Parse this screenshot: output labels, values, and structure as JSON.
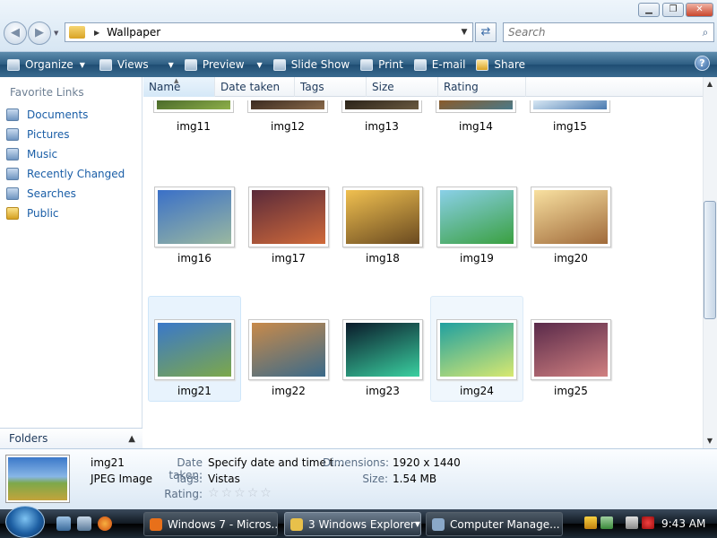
{
  "window": {
    "minimize": "▁",
    "maximize": "❐",
    "close": "✕"
  },
  "address": {
    "path": "Wallpaper",
    "search_placeholder": "Search"
  },
  "toolbar": {
    "organize": "Organize",
    "views": "Views",
    "preview": "Preview",
    "slideshow": "Slide Show",
    "print": "Print",
    "email": "E-mail",
    "share": "Share",
    "help": "?"
  },
  "nav": {
    "favorite_links_title": "Favorite Links",
    "items": [
      {
        "label": "Documents",
        "icon": "documents-icon"
      },
      {
        "label": "Pictures",
        "icon": "pictures-icon"
      },
      {
        "label": "Music",
        "icon": "music-icon"
      },
      {
        "label": "Recently Changed",
        "icon": "recently-changed-icon"
      },
      {
        "label": "Searches",
        "icon": "searches-icon"
      },
      {
        "label": "Public",
        "icon": "public-folder-icon"
      }
    ],
    "folders_label": "Folders"
  },
  "columns": [
    "Name",
    "Date taken",
    "Tags",
    "Size",
    "Rating"
  ],
  "files": [
    {
      "name": "img11",
      "colors": [
        "#4a6a2a",
        "#8fb04a"
      ],
      "partial": true
    },
    {
      "name": "img12",
      "colors": [
        "#3a2a20",
        "#8a6a4a"
      ],
      "partial": true
    },
    {
      "name": "img13",
      "colors": [
        "#2a2218",
        "#6a5a40"
      ],
      "partial": true
    },
    {
      "name": "img14",
      "colors": [
        "#8a5a2a",
        "#4a7a8a"
      ],
      "partial": true
    },
    {
      "name": "img15",
      "colors": [
        "#d8e8f4",
        "#4a7ab0"
      ],
      "partial": true
    },
    {
      "name": "img16",
      "colors": [
        "#3a70c8",
        "#9ab8a0"
      ]
    },
    {
      "name": "img17",
      "colors": [
        "#5a2a3a",
        "#d06a3a"
      ]
    },
    {
      "name": "img18",
      "colors": [
        "#f0c050",
        "#6a4a20"
      ]
    },
    {
      "name": "img19",
      "colors": [
        "#8ad0e8",
        "#3aa040"
      ]
    },
    {
      "name": "img20",
      "colors": [
        "#f8e0a0",
        "#a06a3a"
      ]
    },
    {
      "name": "img21",
      "colors": [
        "#3a78c9",
        "#7da84a"
      ],
      "selected": true
    },
    {
      "name": "img22",
      "colors": [
        "#c88a4a",
        "#3a6a8a"
      ]
    },
    {
      "name": "img23",
      "colors": [
        "#0a1a2a",
        "#3ad0a0"
      ]
    },
    {
      "name": "img24",
      "colors": [
        "#20a0a0",
        "#d8e870"
      ],
      "hover": true
    },
    {
      "name": "img25",
      "colors": [
        "#5a2a4a",
        "#d08080"
      ]
    }
  ],
  "details": {
    "name": "img21",
    "type": "JPEG Image",
    "date_label": "Date taken:",
    "date_value": "Specify date and time t...",
    "tags_label": "Tags:",
    "tags_value": "Vistas",
    "rating_label": "Rating:",
    "rating_stars": 0,
    "dimensions_label": "Dimensions:",
    "dimensions_value": "1920 x 1440",
    "size_label": "Size:",
    "size_value": "1.54 MB"
  },
  "taskbar": {
    "tasks": [
      {
        "label": "Windows 7 - Micros...",
        "icon": "firefox-icon",
        "color": "#e8701a"
      },
      {
        "label": "3 Windows Explorer",
        "icon": "explorer-folder-icon",
        "color": "#e8c04a",
        "active": true
      },
      {
        "label": "Computer Manage...",
        "icon": "computer-management-icon",
        "color": "#8aa8c8"
      }
    ],
    "clock": "9:43 AM"
  }
}
